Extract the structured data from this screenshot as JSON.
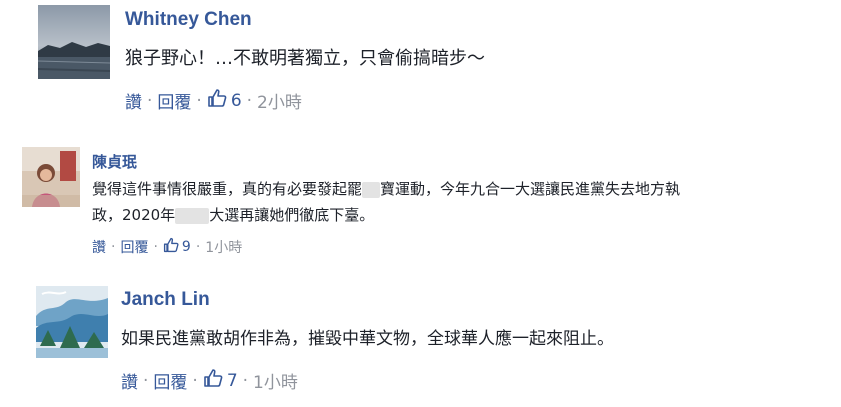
{
  "comments": [
    {
      "author": "Whitney Chen",
      "text": "狼子野心！…不敢明著獨立，只會偷搞暗步～",
      "like_label": "讚",
      "reply_label": "回覆",
      "like_count": "6",
      "time": "2小時"
    },
    {
      "author": "陳貞珉",
      "text_line1_a": "覺得這件事情很嚴重，真的有必要發起罷",
      "text_line1_b": "寶運動，今年九合一大選讓民進黨失去地方執",
      "text_line2_a": "政，2020年",
      "text_line2_b": "大選再讓她們徹底下臺。",
      "like_label": "讚",
      "reply_label": "回覆",
      "like_count": "9",
      "time": "1小時"
    },
    {
      "author": "Janch Lin",
      "text": "如果民進黨敢胡作非為，摧毀中華文物，全球華人應一起來阻止。",
      "like_label": "讚",
      "reply_label": "回覆",
      "like_count": "7",
      "time": "1小時"
    }
  ],
  "colors": {
    "link": "#365899",
    "text": "#1d2129",
    "meta": "#90949c"
  }
}
